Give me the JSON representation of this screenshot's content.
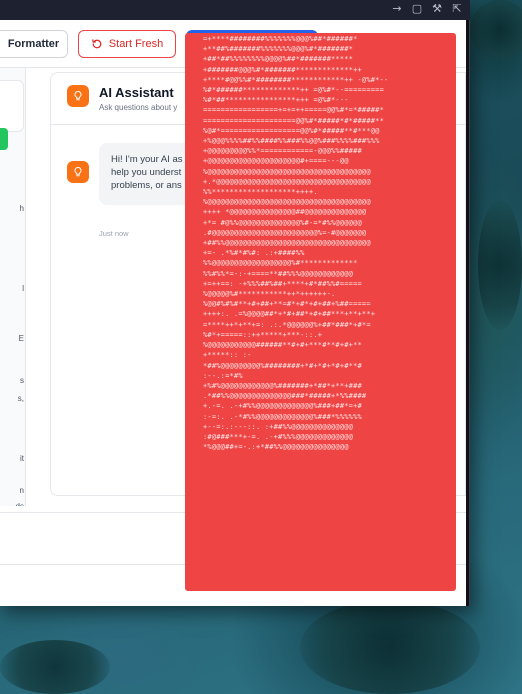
{
  "window": {
    "title_icons": [
      "arrow-right-icon",
      "comment-icon",
      "wrench-icon",
      "external-link-icon"
    ]
  },
  "toolbar": {
    "formatter_label": "Formatter",
    "start_fresh_label": "Start Fresh"
  },
  "left_panel": {
    "snippets": [
      "h",
      "l",
      "E",
      "s",
      "s,",
      "it",
      "n",
      "ds"
    ]
  },
  "assistant": {
    "title": "AI Assistant",
    "subtitle": "Ask questions about y",
    "message_lines": [
      "Hi! I'm your AI as",
      "help you underst",
      "problems, or ans"
    ],
    "message_time": "Just now"
  },
  "overlay": {
    "lines": [
      "=+****########%%%%%%%@@@%##*######*",
      "+**##%#######%%%%%%%@@@%#*#######*",
      "+##*##%%%%%%%%@@@@%##*#######*****",
      "+#######@@@%#*#######*************++",
      "+****#@@%%#*########************++ -@%#*--",
      "%#*######*************++ =@%#*--=========",
      "%#*##****************+++ =@%#*---",
      "=================+=+=++=====@@%#*=*#####*",
      "=====================@@%#*#####*#*#####**",
      "%@#*==================@@%#*#####**#***@@",
      "+%@@@%%%%##%%####%%###%%@@%###%%%%###%%%",
      "+@@@@@@@@@%%*============-@@@%%#####",
      "+@@@@@@@@@@@@@@@@@@@@@#+====---@@",
      "%@@@@@@@@@@@@@@@@@@@@@@@@@@@@@@@@@@@@@",
      "+.*@@@@@@@@@@@@@@@@@@@@@@@@@@@@@@@@@@@",
      "%%*******************++++.",
      "%@@@@@@@@@@@@@@@@@@@@@@@@@@@@@@@@@@@@@",
      "++++ *@@@@@@@@@@@@@@@##@@@@@@@@@@@@@@",
      "+*= #@%%@@@@@@@@@@@@@@%#-=*#%%@@@@@@",
      ".#@@@@@@@@@@@@@@@@@@@@@@@@%=-#@@@@@@@",
      "+##%%@@@@@@@@@@@@@@@@@@@@@@@@@@@@@@@@@",
      "+=- .*%#*#%#: .:+####%%",
      "%%@@@@@@@@@@@@@@@@@@%#*************",
      "%%#%%*=-:-+====**##%%%@@@@@@@@@@@@",
      "+=++==: -+%%%##%##+****+#*##%%#=====",
      "%@@@@@%#***********++*++++++-.",
      "%@@#%#%#**+#+##+**=#*+#*+#+##+%##=====",
      "++++:. .=%@@@@##*+*#+##*+#+##***+**+**+",
      "=****++*+**+=: .:.*@@@@@@%+##*###*+#*=",
      "%#*+=====::++*****+***-::.+",
      "%@@@@@@@@@@@######**#+#+***#**#+#+**",
      "+*****:: :-",
      "*##%@@@@@@@@@%########+*#+*#+*#+#**#",
      ":--.:=*#%",
      "+%#%@@@@@@@@@@@@%#######+*##*+**+###",
      ".*##%%@@@@@@@@@@@@@@###*#####+*%%####",
      "+.-=. .-+#%%@@@@@@@@@@@@@%###+##*=+#",
      ":-=:. .-*#%%@@@@@@@@@@@@@%###*%%%%%%",
      "+--=:.:---::. :+##%%@@@@@@@@@@@@@@",
      ":#@###***+-=. .-+#%%%@@@@@@@@@@@@@",
      "*%@@@##+=-.:+*##%%@@@@@@@@@@@@@@@"
    ]
  }
}
